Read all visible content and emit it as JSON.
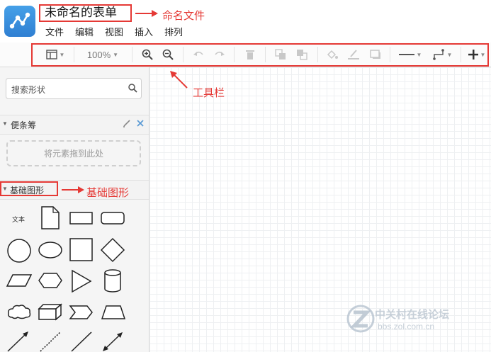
{
  "app": {
    "title": "未命名的表单"
  },
  "menu": [
    "文件",
    "编辑",
    "视图",
    "插入",
    "排列"
  ],
  "annotations": {
    "name_file": "命名文件",
    "toolbar": "工具栏",
    "basic_shapes": "基础图形"
  },
  "toolbar": {
    "zoom": "100%",
    "icons": [
      "page-layout-icon",
      "zoom-in-icon",
      "zoom-out-icon",
      "undo-icon",
      "redo-icon",
      "delete-icon",
      "to-front-icon",
      "to-back-icon",
      "fill-color-icon",
      "line-color-icon",
      "shadow-icon",
      "line-style-icon",
      "connector-style-icon",
      "insert-plus-icon"
    ]
  },
  "sidebar": {
    "search_placeholder": "搜索形状",
    "sections": {
      "notes": {
        "title": "便条筹",
        "drop_hint": "将元素拖到此处"
      },
      "basic": {
        "title": "基础图形"
      }
    },
    "shapes": {
      "text_label": "文本",
      "items": [
        "text",
        "document",
        "rectangle",
        "rounded-rectangle",
        "circle",
        "ellipse",
        "square",
        "diamond",
        "parallelogram",
        "hexagon",
        "triangle",
        "cylinder",
        "cloud",
        "cube",
        "step",
        "trapezoid",
        "arrow-line",
        "dotted-line",
        "line",
        "bidirectional-arrow"
      ]
    }
  },
  "watermark": {
    "name": "中关村在线论坛",
    "url": "bbs.zol.com.cn"
  },
  "colors": {
    "accent": "#e53935",
    "logo": "#3a8fdf"
  }
}
